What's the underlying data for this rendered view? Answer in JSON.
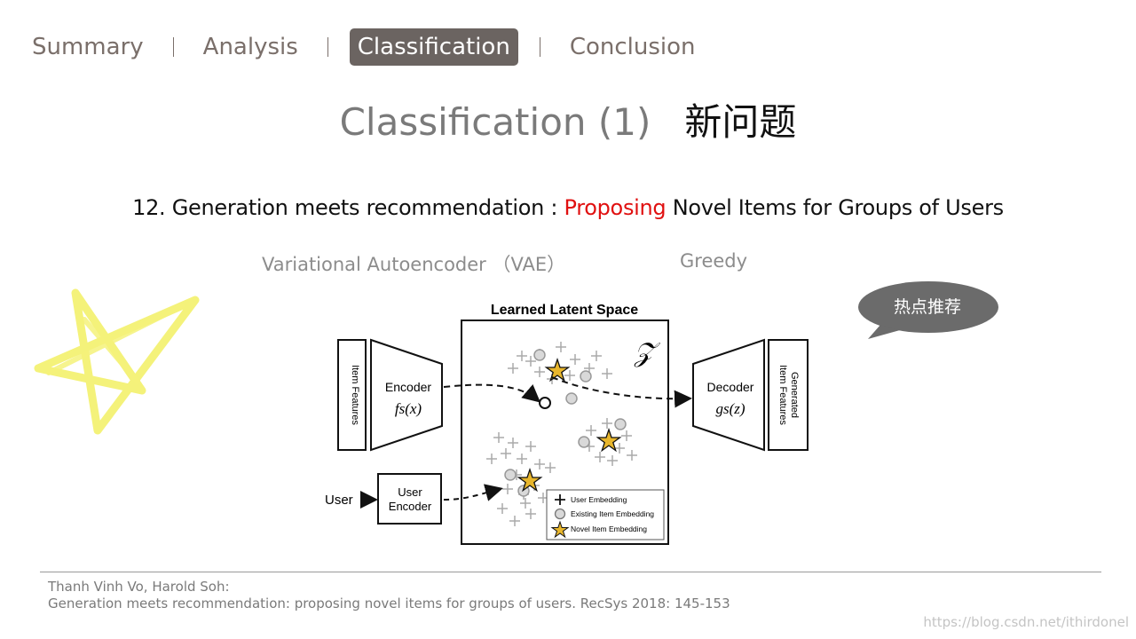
{
  "nav": {
    "items": [
      "Summary",
      "Analysis",
      "Classification",
      "Conclusion"
    ],
    "active": "Classification"
  },
  "title": {
    "main": "Classification (1)",
    "cn": "新问题"
  },
  "subtitle": {
    "prefix": "12. Generation meets recommendation : ",
    "highlight": "Proposing",
    "suffix": " Novel Items for Groups of Users"
  },
  "labels": {
    "vae": "Variational Autoencoder （VAE）",
    "greedy": "Greedy"
  },
  "bubble": {
    "text": "热点推荐"
  },
  "diagram": {
    "space_title": "Learned Latent Space",
    "z_symbol": "𝒵",
    "item_features": "Item Features",
    "encoder": "Encoder",
    "encoder_fn": "fs(x)",
    "decoder": "Decoder",
    "decoder_fn": "gs(z)",
    "generated": "Generated",
    "generated2": "Item Features",
    "user": "User",
    "user_encoder_1": "User",
    "user_encoder_2": "Encoder",
    "legend": [
      "User Embedding",
      "Existing Item Embedding",
      "Novel Item Embedding"
    ]
  },
  "citation": {
    "line1": "Thanh Vinh Vo, Harold Soh:",
    "line2": "Generation meets recommendation: proposing novel items for groups of users. RecSys 2018: 145-153"
  },
  "watermark": "https://blog.csdn.net/ithirdonel",
  "colors": {
    "highlight": "#e01010",
    "nav_active_bg": "#6b6461",
    "doodle": "#f4f27a",
    "star": "#e8b62c",
    "bubble": "#6b6b6b"
  }
}
